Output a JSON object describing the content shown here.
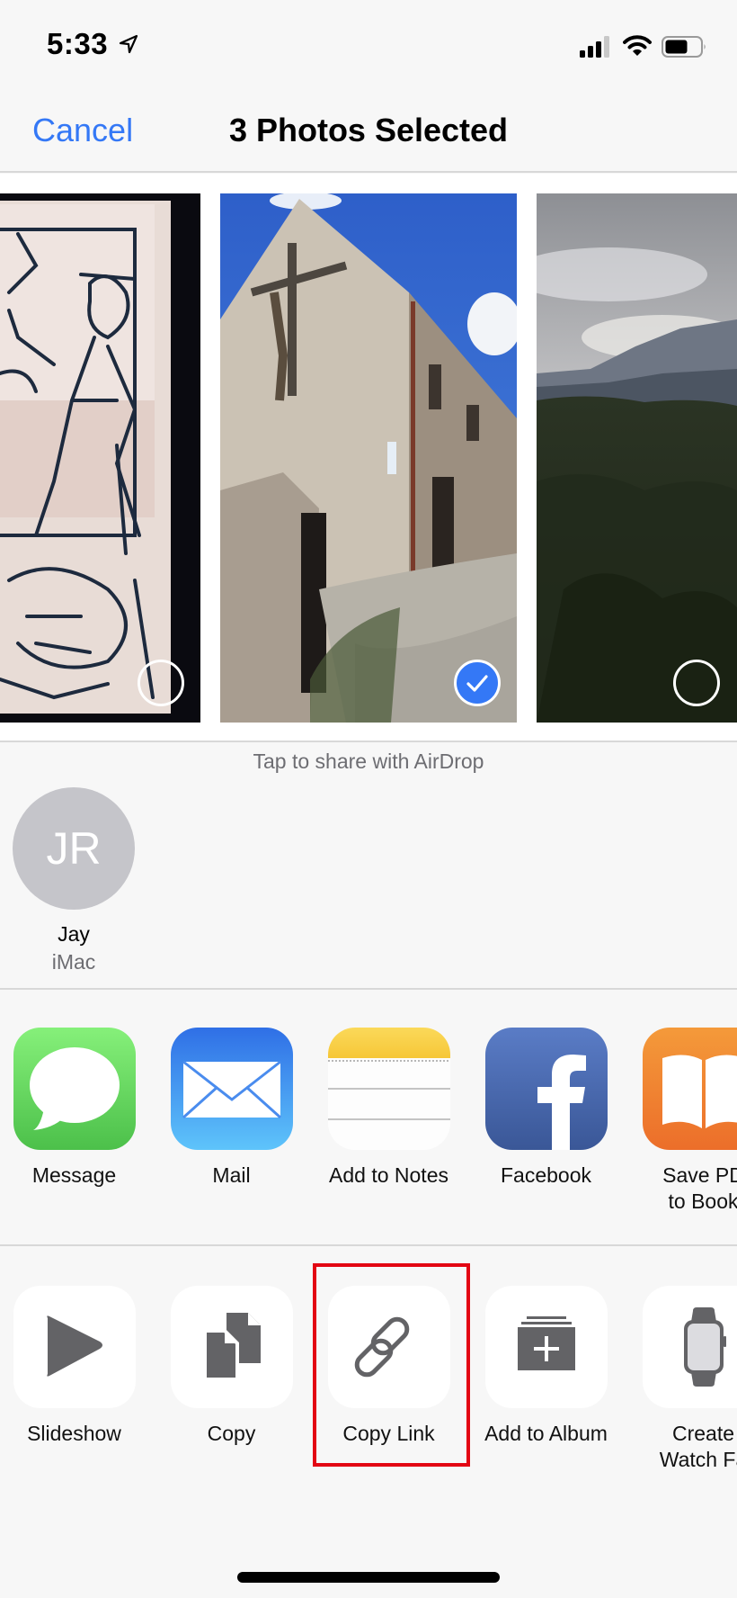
{
  "status_bar": {
    "time": "5:33",
    "location_icon": "location-arrow-icon",
    "signal_icon": "cellular-signal-icon",
    "signal_bars": 3,
    "signal_bars_total": 4,
    "wifi_icon": "wifi-icon",
    "battery_icon": "battery-icon",
    "battery_level_percent": 60
  },
  "nav": {
    "cancel_label": "Cancel",
    "title": "3 Photos Selected"
  },
  "photos": [
    {
      "name": "woodcut-drawing",
      "selected": false
    },
    {
      "name": "stone-house-with-crucifix",
      "selected": true
    },
    {
      "name": "forest-mountains",
      "selected": false
    }
  ],
  "airdrop": {
    "hint": "Tap to share with AirDrop",
    "people": [
      {
        "initials": "JR",
        "name": "Jay",
        "device": "iMac"
      }
    ]
  },
  "share_apps": [
    {
      "label": "Message",
      "icon": "messages-icon"
    },
    {
      "label": "Mail",
      "icon": "mail-icon"
    },
    {
      "label": "Add to Notes",
      "icon": "notes-icon"
    },
    {
      "label": "Facebook",
      "icon": "facebook-icon"
    },
    {
      "label": "Save PDF\nto Books",
      "label_visible": "Save PD to Book",
      "icon": "books-icon"
    }
  ],
  "actions": [
    {
      "label": "Slideshow",
      "icon": "play-icon"
    },
    {
      "label": "Copy",
      "icon": "copy-documents-icon"
    },
    {
      "label": "Copy Link",
      "icon": "link-icon",
      "highlighted": true
    },
    {
      "label": "Add to Album",
      "icon": "add-to-album-icon"
    },
    {
      "label": "Create\nWatch Face",
      "label_visible": "Create Watch Fa",
      "icon": "apple-watch-icon"
    }
  ],
  "colors": {
    "accent": "#3478f6",
    "highlight": "#e30613",
    "action_glyph": "#636366",
    "avatar_bg": "#c5c5ca"
  }
}
